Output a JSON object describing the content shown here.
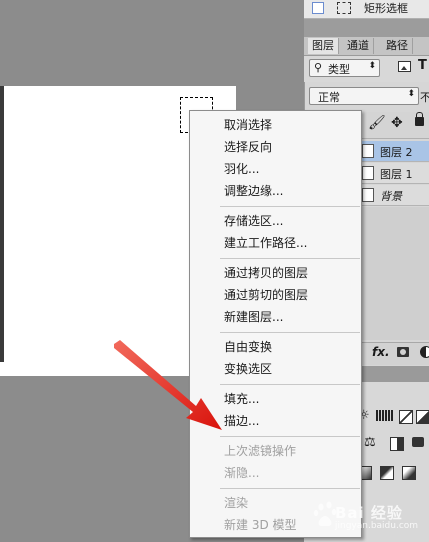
{
  "panel_top": {
    "label": "矩形选框"
  },
  "tabs": [
    {
      "label": "图层"
    },
    {
      "label": "通道"
    },
    {
      "label": "路径"
    }
  ],
  "layers_panel": {
    "filter_label": "类型",
    "blend_mode": "正常",
    "layers": [
      {
        "name": "图层 2"
      },
      {
        "name": "图层 1"
      },
      {
        "name": "背景"
      }
    ],
    "fx_label": "fx."
  },
  "context_menu": {
    "items": [
      {
        "label": "取消选择",
        "enabled": true
      },
      {
        "label": "选择反向",
        "enabled": true
      },
      {
        "label": "羽化...",
        "enabled": true
      },
      {
        "label": "调整边缘...",
        "enabled": true
      },
      {
        "label": "存储选区...",
        "enabled": true
      },
      {
        "label": "建立工作路径...",
        "enabled": true
      },
      {
        "label": "通过拷贝的图层",
        "enabled": true
      },
      {
        "label": "通过剪切的图层",
        "enabled": true
      },
      {
        "label": "新建图层...",
        "enabled": true
      },
      {
        "label": "自由变换",
        "enabled": true
      },
      {
        "label": "变换选区",
        "enabled": true
      },
      {
        "label": "填充...",
        "enabled": true
      },
      {
        "label": "描边...",
        "enabled": true
      },
      {
        "label": "上次滤镜操作",
        "enabled": false
      },
      {
        "label": "渐隐...",
        "enabled": false
      },
      {
        "label": "渲染",
        "enabled": false
      },
      {
        "label": "新建 3D 模型",
        "enabled": false
      }
    ]
  },
  "watermark": {
    "text": "Bai 经验",
    "url": "jingyan.baidu.com"
  },
  "colors": {
    "arrow": "#e8201a",
    "selected_layer": "#a9c4e6",
    "disabled_text": "#a0a0a0"
  }
}
